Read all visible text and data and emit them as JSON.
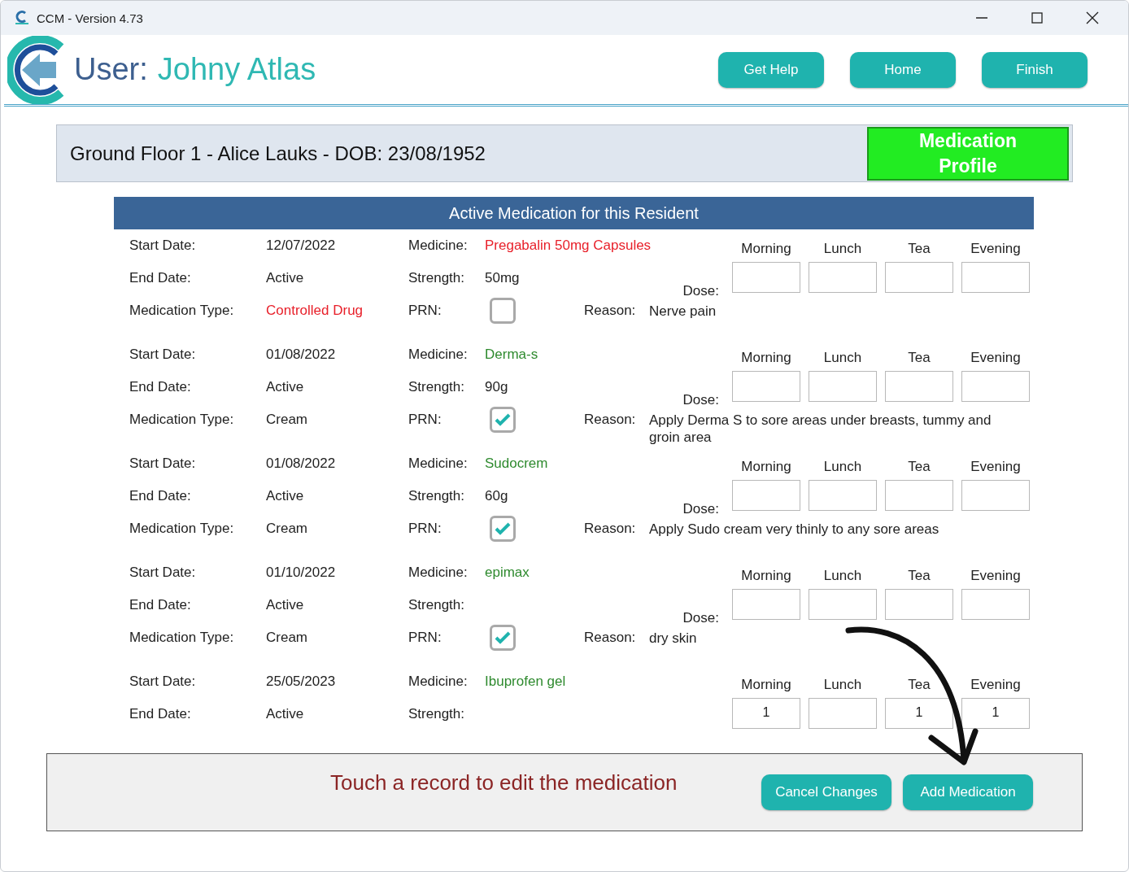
{
  "window": {
    "title": "CCM - Version 4.73"
  },
  "header": {
    "user_label": "User:",
    "user_name": "Johny Atlas",
    "buttons": [
      "Get Help",
      "Home",
      "Finish"
    ]
  },
  "resident": {
    "summary": "Ground Floor 1 - Alice Lauks - DOB: 23/08/1952",
    "profile_button": "Medication Profile"
  },
  "table": {
    "title": "Active Medication for this Resident",
    "records": [
      {
        "kind": "controlled",
        "start_date": {
          "label": "Start Date:",
          "value": "12/07/2022"
        },
        "end_date": {
          "label": "End Date:",
          "value": "Active"
        },
        "medication_type": {
          "label": "Medication Type:",
          "value": "Controlled Drug"
        },
        "medicine": {
          "label": "Medicine:",
          "value": "Pregabalin 50mg Capsules"
        },
        "strength": {
          "label": "Strength:",
          "value": "50mg"
        },
        "prn": {
          "label": "PRN:",
          "checked": false
        },
        "reason": {
          "label": "Reason:",
          "value": "Nerve pain"
        },
        "dose_label": "Dose:",
        "dose_slots": [
          {
            "header": "Morning"
          },
          {
            "header": "Lunch"
          },
          {
            "header": "Tea"
          },
          {
            "header": "Evening"
          }
        ]
      },
      {
        "kind": "standard",
        "start_date": {
          "label": "Start Date:",
          "value": "01/08/2022"
        },
        "end_date": {
          "label": "End Date:",
          "value": "Active"
        },
        "medication_type": {
          "label": "Medication Type:",
          "value": "Cream"
        },
        "medicine": {
          "label": "Medicine:",
          "value": "Derma-s"
        },
        "strength": {
          "label": "Strength:",
          "value": "90g"
        },
        "prn": {
          "label": "PRN:",
          "checked": true
        },
        "reason": {
          "label": "Reason:",
          "value": "Apply Derma S to sore areas under breasts, tummy and groin area"
        },
        "dose_label": "Dose:",
        "dose_slots": [
          {
            "header": "Morning"
          },
          {
            "header": "Lunch"
          },
          {
            "header": "Tea"
          },
          {
            "header": "Evening"
          }
        ]
      },
      {
        "kind": "standard",
        "start_date": {
          "label": "Start Date:",
          "value": "01/08/2022"
        },
        "end_date": {
          "label": "End Date:",
          "value": "Active"
        },
        "medication_type": {
          "label": "Medication Type:",
          "value": "Cream"
        },
        "medicine": {
          "label": "Medicine:",
          "value": "Sudocrem"
        },
        "strength": {
          "label": "Strength:",
          "value": "60g"
        },
        "prn": {
          "label": "PRN:",
          "checked": true
        },
        "reason": {
          "label": "Reason:",
          "value": "Apply Sudo cream very thinly to any sore areas"
        },
        "dose_label": "Dose:",
        "dose_slots": [
          {
            "header": "Morning"
          },
          {
            "header": "Lunch"
          },
          {
            "header": "Tea"
          },
          {
            "header": "Evening"
          }
        ]
      },
      {
        "kind": "standard",
        "start_date": {
          "label": "Start Date:",
          "value": "01/10/2022"
        },
        "end_date": {
          "label": "End Date:",
          "value": "Active"
        },
        "medication_type": {
          "label": "Medication Type:",
          "value": "Cream"
        },
        "medicine": {
          "label": "Medicine:",
          "value": "epimax"
        },
        "strength": {
          "label": "Strength:"
        },
        "prn": {
          "label": "PRN:",
          "checked": true
        },
        "reason": {
          "label": "Reason:",
          "value": "dry skin"
        },
        "dose_label": "Dose:",
        "dose_slots": [
          {
            "header": "Morning"
          },
          {
            "header": "Lunch"
          },
          {
            "header": "Tea"
          },
          {
            "header": "Evening"
          }
        ]
      },
      {
        "kind": "standard",
        "start_date": {
          "label": "Start Date:",
          "value": "25/05/2023"
        },
        "end_date": {
          "label": "End Date:",
          "value": "Active"
        },
        "medicine": {
          "label": "Medicine:",
          "value": "Ibuprofen gel"
        },
        "strength": {
          "label": "Strength:"
        },
        "dose_slots": [
          {
            "header": "Morning",
            "value": "1"
          },
          {
            "header": "Lunch"
          },
          {
            "header": "Tea",
            "value": "1"
          },
          {
            "header": "Evening",
            "value": "1"
          }
        ]
      }
    ]
  },
  "footer": {
    "hint": "Touch a record to edit the medication",
    "buttons": [
      "Cancel Changes",
      "Add Medication"
    ]
  }
}
